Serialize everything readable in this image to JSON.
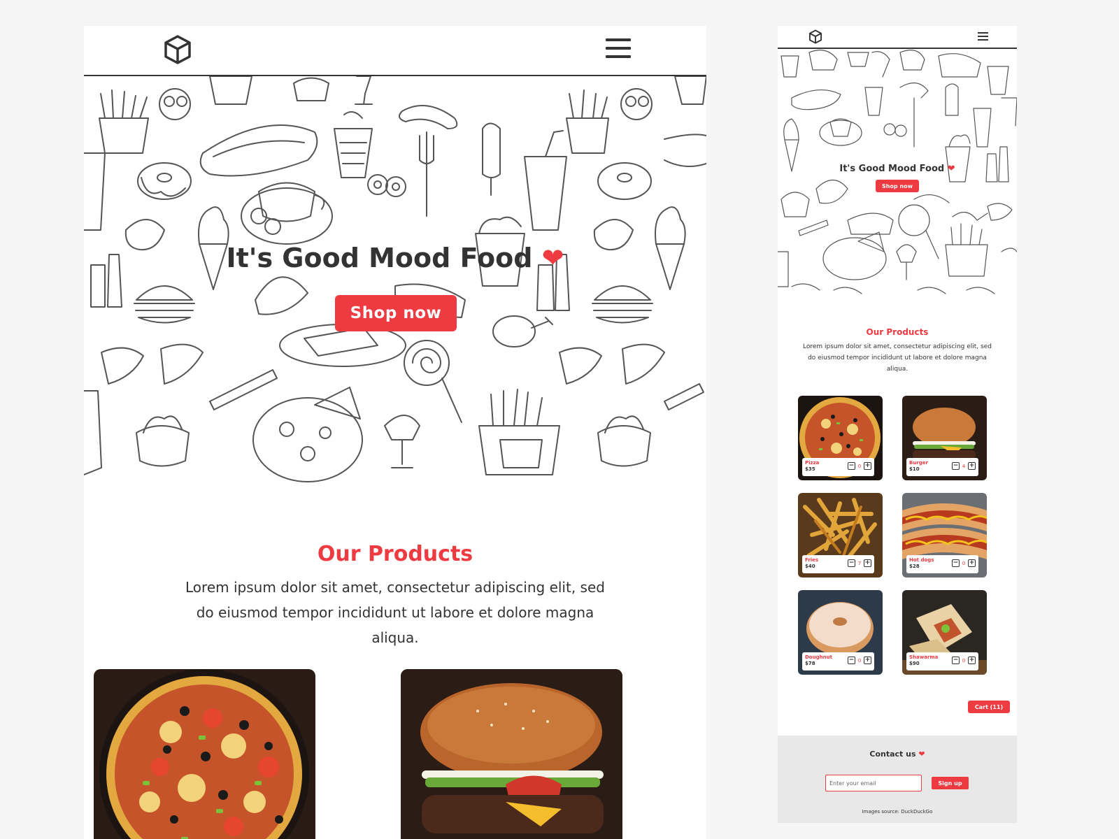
{
  "desktop": {
    "nav": {
      "logo_icon": "cube-icon",
      "menu_icon": "hamburger-menu-icon"
    },
    "hero": {
      "title": "It's Good Mood Food",
      "heart_icon": "heart-icon",
      "shop_button_label": "Shop now"
    },
    "products": {
      "title": "Our Products",
      "description": "Lorem ipsum dolor sit amet, consectetur adipiscing elit, sed do eiusmod tempor incididunt ut labore et dolore magna aliqua.",
      "cards": [
        {
          "image": "pizza"
        },
        {
          "image": "burger"
        }
      ]
    }
  },
  "mobile": {
    "nav": {
      "logo_icon": "cube-icon",
      "menu_icon": "hamburger-menu-icon"
    },
    "hero": {
      "title": "It's Good Mood Food",
      "heart_icon": "heart-icon",
      "shop_button_label": "Shop now"
    },
    "products": {
      "title": "Our Products",
      "description": "Lorem ipsum dolor sit amet, consectetur adipiscing elit, sed do eiusmod tempor incididunt ut labore et dolore magna aliqua.",
      "items": [
        {
          "name": "Pizza",
          "price": "$35",
          "qty": "0"
        },
        {
          "name": "Burger",
          "price": "$10",
          "qty": "4"
        },
        {
          "name": "Fries",
          "price": "$40",
          "qty": "7"
        },
        {
          "name": "Hot dogs",
          "price": "$28",
          "qty": "0"
        },
        {
          "name": "Doughnut",
          "price": "$78",
          "qty": "0"
        },
        {
          "name": "Shawarma",
          "price": "$90",
          "qty": "0"
        }
      ],
      "minus_icon": "minus-square-icon",
      "plus_icon": "plus-square-icon"
    },
    "cart_label": "Cart (11)",
    "footer": {
      "contact_title": "Contact us",
      "email_placeholder": "Enter your email",
      "signup_label": "Sign up",
      "source_text": "Images source: DuckDuckGo"
    }
  },
  "colors": {
    "accent": "#ee3a41",
    "text": "#333333",
    "footer_bg": "#e8e8e8",
    "page_bg": "#f5f5f5"
  }
}
